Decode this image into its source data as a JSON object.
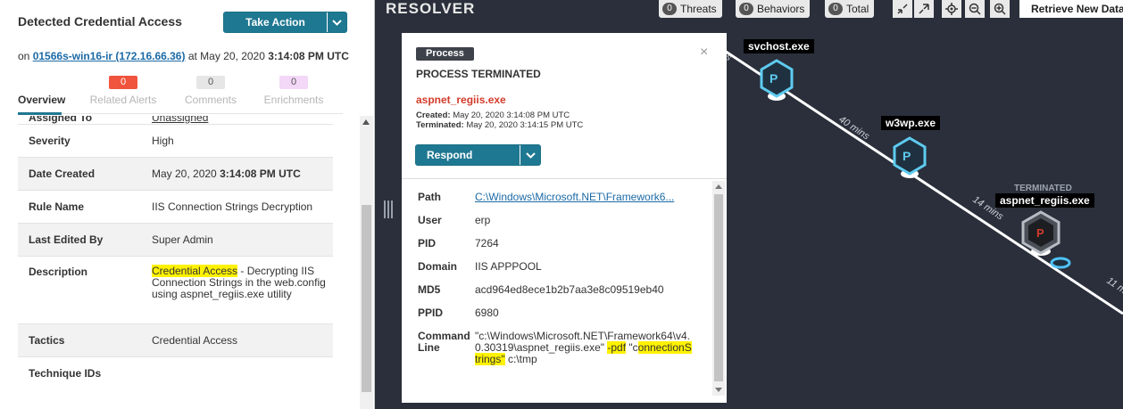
{
  "detection": {
    "title": "Detected Credential Access",
    "take_action_label": "Take Action",
    "on_prefix": "on",
    "host": "01566s-win16-ir (172.16.66.36)",
    "at_text": "at May 20, 2020",
    "time": "3:14:08 PM UTC"
  },
  "tabs": [
    {
      "label": "Overview",
      "badge": ""
    },
    {
      "label": "Related Alerts",
      "badge": "0",
      "badge_color": "#f0543c",
      "badge_text_color": "#ffffff"
    },
    {
      "label": "Comments",
      "badge": "0",
      "badge_color": "#e6e6e6",
      "badge_text_color": "#555555"
    },
    {
      "label": "Enrichments",
      "badge": "0",
      "badge_color": "#f4d8f7",
      "badge_text_color": "#555555"
    }
  ],
  "details": {
    "cut_key": "Assigned To",
    "cut_value": "Unassigned",
    "severity_label": "Severity",
    "severity_value": "High",
    "date_label": "Date Created",
    "date_value": "May 20, 2020",
    "date_time": "3:14:08 PM UTC",
    "rule_label": "Rule Name",
    "rule_value": "IIS Connection Strings Decryption",
    "edited_label": "Last Edited By",
    "edited_value": "Super Admin",
    "desc_label": "Description",
    "desc_highlight": "Credential Access",
    "desc_rest": " - Decrypting IIS Connection Strings in the web.config using aspnet_regiis.exe utility",
    "tactics_label": "Tactics",
    "tactics_value": "Credential Access",
    "technique_label": "Technique IDs",
    "technique_value": ""
  },
  "resolver": {
    "title": "RESOLVER",
    "counters": [
      {
        "count": "0",
        "label": "Threats"
      },
      {
        "count": "0",
        "label": "Behaviors"
      },
      {
        "count": "0",
        "label": "Total"
      }
    ],
    "retrieve_label": "Retrieve New Data",
    "nodes": [
      {
        "label": "svchost.exe",
        "letter": "P"
      },
      {
        "label": "w3wp.exe",
        "letter": "P"
      },
      {
        "label": "aspnet_regiis.exe",
        "letter": "P",
        "caption": "TERMINATED"
      }
    ],
    "edges": [
      "40 mins",
      "14 mins",
      "11 m"
    ],
    "edge_left": "s"
  },
  "popup": {
    "badge": "Process",
    "status": "PROCESS TERMINATED",
    "name": "aspnet_regiis.exe",
    "created_label": "Created:",
    "created_value": "May 20, 2020 3:14:08 PM UTC",
    "terminated_label": "Terminated:",
    "terminated_value": "May 20, 2020 3:14:15 PM UTC",
    "respond_label": "Respond",
    "close_glyph": "×",
    "rows": {
      "path_label": "Path",
      "path_value": "C:\\Windows\\Microsoft.NET\\Framework6...",
      "user_label": "User",
      "user_value": "erp",
      "pid_label": "PID",
      "pid_value": "7264",
      "domain_label": "Domain",
      "domain_value": "IIS APPPOOL",
      "md5_label": "MD5",
      "md5_value": "acd964ed8ece1b2b7aa3e8c09519eb40",
      "ppid_label": "PPID",
      "ppid_value": "6980",
      "cmd_label": "Command Line",
      "cmd_part1": "\"c:\\Windows\\Microsoft.NET\\Framework64\\v4.0.30319\\aspnet_regiis.exe\" ",
      "cmd_hl1": "-pdf",
      "cmd_part2": " \"c",
      "cmd_hl2": "onnectionStrings\"",
      "cmd_part3": " c:\\tmp"
    }
  },
  "colors": {
    "accent": "#1f7891",
    "danger": "#d23b2a",
    "highlight": "#fff200",
    "graph_bg": "#2a2f3b",
    "node_blue": "#4fc3f7"
  }
}
